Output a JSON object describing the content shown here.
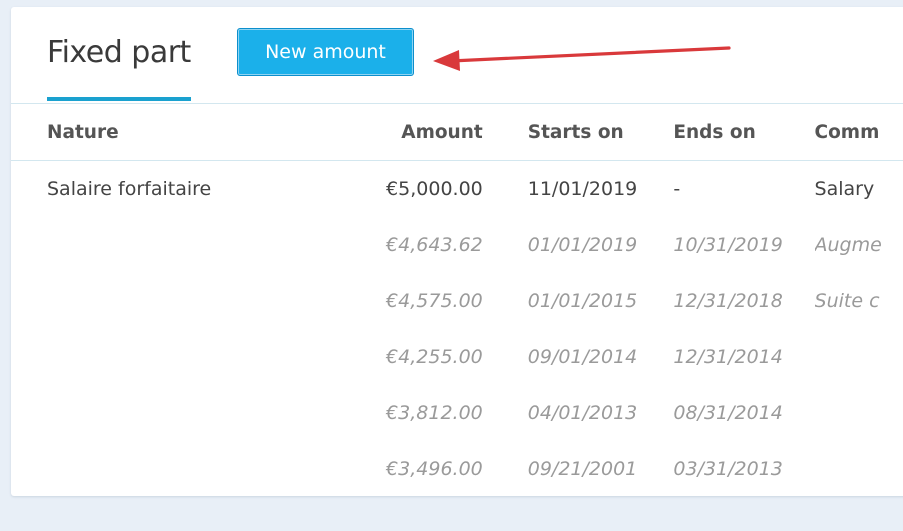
{
  "section": {
    "title": "Fixed part",
    "new_button_label": "New amount"
  },
  "table": {
    "columns": [
      "Nature",
      "Amount",
      "Starts on",
      "Ends on",
      "Comm"
    ],
    "rows": [
      {
        "nature": "Salaire forfaitaire",
        "amount": "€5,000.00",
        "starts": "11/01/2019",
        "ends": "-",
        "comment": "Salary",
        "current": true
      },
      {
        "nature": "",
        "amount": "€4,643.62",
        "starts": "01/01/2019",
        "ends": "10/31/2019",
        "comment": "Augme",
        "current": false
      },
      {
        "nature": "",
        "amount": "€4,575.00",
        "starts": "01/01/2015",
        "ends": "12/31/2018",
        "comment": "Suite c",
        "current": false
      },
      {
        "nature": "",
        "amount": "€4,255.00",
        "starts": "09/01/2014",
        "ends": "12/31/2014",
        "comment": "",
        "current": false
      },
      {
        "nature": "",
        "amount": "€3,812.00",
        "starts": "04/01/2013",
        "ends": "08/31/2014",
        "comment": "",
        "current": false
      },
      {
        "nature": "",
        "amount": "€3,496.00",
        "starts": "09/21/2001",
        "ends": "03/31/2013",
        "comment": "",
        "current": false
      }
    ]
  },
  "colors": {
    "accent": "#1aa1cf",
    "button": "#1bb0ea",
    "annotation_arrow": "#d9393b",
    "background": "#e8eff7"
  }
}
